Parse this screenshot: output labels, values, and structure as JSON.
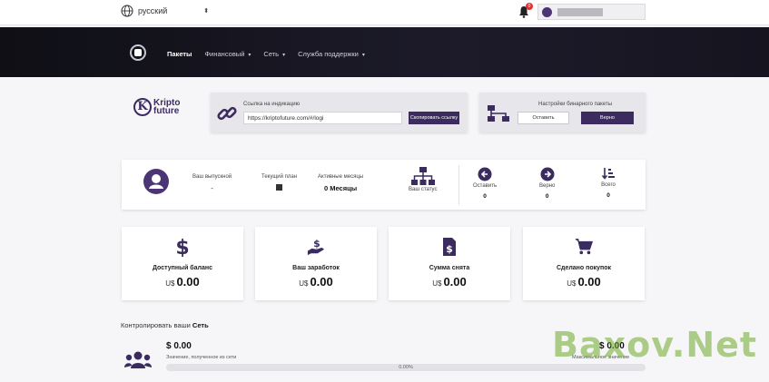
{
  "topbar": {
    "language": "русский",
    "notifications_count": "0"
  },
  "nav": {
    "items": [
      {
        "label": "Пакеты",
        "active": true,
        "dropdown": false
      },
      {
        "label": "Финансовый",
        "active": false,
        "dropdown": true
      },
      {
        "label": "Сеть",
        "active": false,
        "dropdown": true
      },
      {
        "label": "Служба поддержки",
        "active": false,
        "dropdown": true
      }
    ]
  },
  "brand": {
    "line1": "Kripto",
    "line2": "future",
    "letter": "K"
  },
  "referral": {
    "label": "Ссылка на индикацию",
    "link_value": "https://kriptofuture.com/#/logi",
    "copy_button": "Скопировать ссылку"
  },
  "binary": {
    "label": "Настройки бинарного пакеты",
    "left_button": "Оставить",
    "right_button": "Верно"
  },
  "profile": {
    "graduate_label": "Ваш выпускной",
    "graduate_value": "-",
    "plan_label": "Текущий план",
    "months_label": "Активные месяцы",
    "months_value": "0 Месяцы",
    "status_label": "Ваш статус",
    "left_label": "Оставить",
    "left_value": "0",
    "right_label": "Верно",
    "right_value": "0",
    "total_label": "Всего",
    "total_value": "0"
  },
  "cards": [
    {
      "icon": "dollar-icon",
      "title": "Доступный баланс",
      "currency": "U$",
      "amount": "0.00"
    },
    {
      "icon": "hand-dollar-icon",
      "title": "Ваш заработок",
      "currency": "U$",
      "amount": "0.00"
    },
    {
      "icon": "receipt-icon",
      "title": "Сумма снята",
      "currency": "U$",
      "amount": "0.00"
    },
    {
      "icon": "cart-icon",
      "title": "Сделано покупок",
      "currency": "U$",
      "amount": "0.00"
    }
  ],
  "network": {
    "heading_prefix": "Контролировать ваши",
    "heading_bold": "Сеть",
    "value_left": "$ 0.00",
    "caption_left": "Значение, полученное из сети",
    "value_right": "$ 0.00",
    "caption_right": "Максимальное значение",
    "progress_percent": 0,
    "progress_text": "0.00%"
  },
  "watermark": "Baxov.Net",
  "colors": {
    "accent": "#3b2b5e",
    "nav_bg": "#16141f",
    "page_bg": "#f6f6f8"
  }
}
